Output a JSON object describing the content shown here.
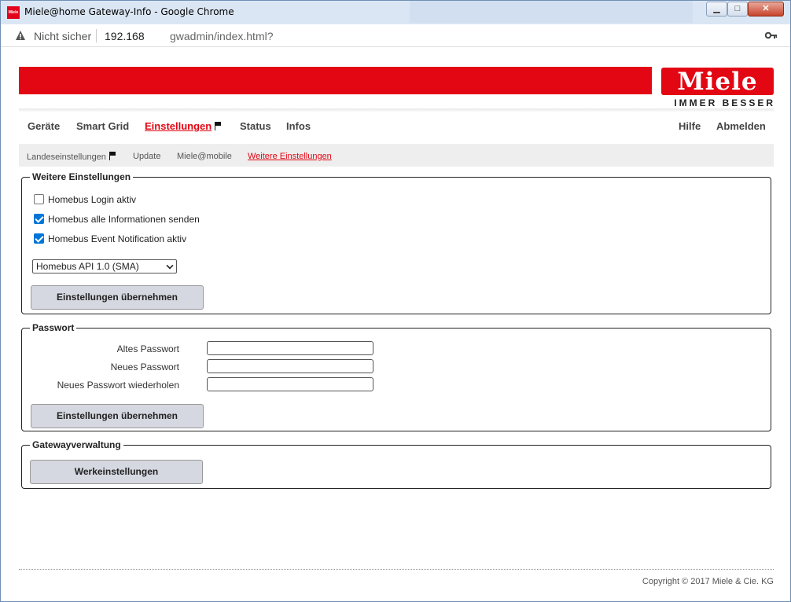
{
  "browser": {
    "window_title": "Miele@home Gateway-Info - Google Chrome",
    "app_icon_text": "Miele",
    "minimize": "▁",
    "maximize": "□",
    "close": "✕",
    "security_label": "Nicht sicher",
    "url_host": "192.168",
    "url_path": "gwadmin/index.html?"
  },
  "header": {
    "logo": "Miele",
    "slogan": "IMMER BESSER"
  },
  "main_nav": {
    "items": [
      "Geräte",
      "Smart Grid",
      "Einstellungen",
      "Status",
      "Infos"
    ],
    "right_items": [
      "Hilfe",
      "Abmelden"
    ]
  },
  "sub_nav": {
    "items": [
      "Landeseinstellungen",
      "Update",
      "Miele@mobile",
      "Weitere Einstellungen"
    ]
  },
  "weitere": {
    "legend": "Weitere Einstellungen",
    "checks": [
      {
        "label": "Homebus Login aktiv",
        "checked": false
      },
      {
        "label": "Homebus alle Informationen senden",
        "checked": true
      },
      {
        "label": "Homebus Event Notification aktiv",
        "checked": true
      }
    ],
    "api_select": "Homebus API 1.0 (SMA)",
    "apply": "Einstellungen übernehmen"
  },
  "passwort": {
    "legend": "Passwort",
    "old": "Altes Passwort",
    "new": "Neues Passwort",
    "repeat": "Neues Passwort wiederholen",
    "old_value": "",
    "new_value": "",
    "repeat_value": "",
    "apply": "Einstellungen übernehmen"
  },
  "gateway": {
    "legend": "Gatewayverwaltung",
    "factory_reset": "Werkeinstellungen"
  },
  "footer": {
    "copyright": "Copyright © 2017 Miele & Cie. KG"
  }
}
